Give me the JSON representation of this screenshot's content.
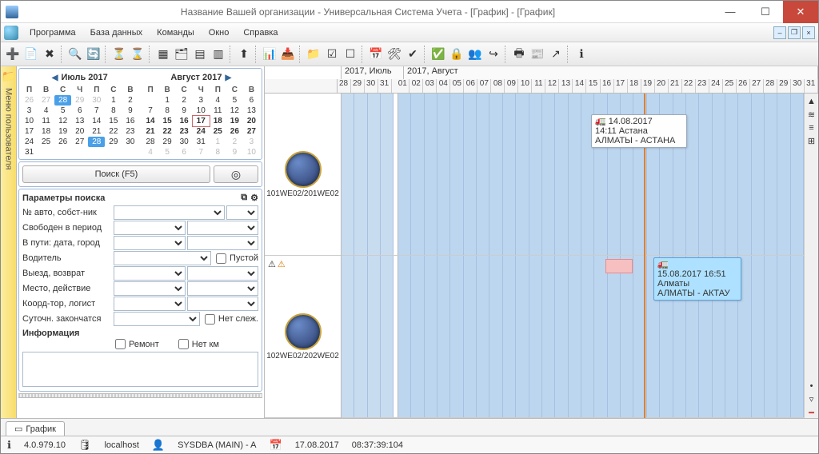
{
  "title": "Название Вашей организации - Универсальная Система Учета - [График] - [График]",
  "menu": {
    "program": "Программа",
    "db": "База данных",
    "cmds": "Команды",
    "window": "Окно",
    "help": "Справка"
  },
  "calendars": {
    "july": {
      "title": "Июль 2017",
      "dow": [
        "П",
        "В",
        "С",
        "Ч",
        "П",
        "С",
        "В"
      ],
      "cells": [
        [
          "26",
          "27",
          "28",
          "29",
          "30",
          "1",
          "2"
        ],
        [
          "3",
          "4",
          "5",
          "6",
          "7",
          "8",
          "9"
        ],
        [
          "10",
          "11",
          "12",
          "13",
          "14",
          "15",
          "16"
        ],
        [
          "17",
          "18",
          "19",
          "20",
          "21",
          "22",
          "23"
        ],
        [
          "24",
          "25",
          "26",
          "27",
          "28",
          "29",
          "30"
        ],
        [
          "31",
          "",
          "",
          "",
          "",
          "",
          ""
        ]
      ]
    },
    "aug": {
      "title": "Август 2017",
      "dow": [
        "П",
        "В",
        "С",
        "Ч",
        "П",
        "С",
        "В"
      ],
      "cells": [
        [
          "",
          "1",
          "2",
          "3",
          "4",
          "5",
          "6"
        ],
        [
          "7",
          "8",
          "9",
          "10",
          "11",
          "12",
          "13"
        ],
        [
          "14",
          "15",
          "16",
          "17",
          "18",
          "19",
          "20"
        ],
        [
          "21",
          "22",
          "23",
          "24",
          "25",
          "26",
          "27"
        ],
        [
          "28",
          "29",
          "30",
          "31",
          "1",
          "2",
          "3"
        ],
        [
          "4",
          "5",
          "6",
          "7",
          "8",
          "9",
          "10"
        ]
      ]
    }
  },
  "search": {
    "btn": "Поиск (F5)"
  },
  "params": {
    "header": "Параметры поиска",
    "rows": {
      "auto": "№ авто, собст-ник",
      "free": "Свободен в период",
      "route": "В пути: дата, город",
      "driver": "Водитель",
      "empty": "Пустой",
      "depart": "Выезд, возврат",
      "place": "Место, действие",
      "coord": "Коорд-тор, логист",
      "daily": "Суточн. закончатся",
      "notrack": "Нет слеж."
    },
    "info": "Информация",
    "repair": "Ремонт",
    "nokm": "Нет км"
  },
  "sidebar": {
    "label": "Меню пользователя"
  },
  "gantt": {
    "months": {
      "jul": "2017, Июль",
      "aug": "2017, Август"
    },
    "julyDays": [
      "28",
      "29",
      "30",
      "31"
    ],
    "augDays": [
      "01",
      "02",
      "03",
      "04",
      "05",
      "06",
      "07",
      "08",
      "09",
      "10",
      "11",
      "12",
      "13",
      "14",
      "15",
      "16",
      "17",
      "18",
      "19",
      "20",
      "21",
      "22",
      "23",
      "24",
      "25",
      "26",
      "27",
      "28",
      "29",
      "30",
      "31"
    ],
    "resources": [
      {
        "code": "101WE02/201WE02"
      },
      {
        "code": "102WE02/202WE02"
      }
    ],
    "events": {
      "e1": {
        "date": "14.08.2017",
        "time": "14:11 Астана",
        "route": "АЛМАТЫ - АСТАНА"
      },
      "e2": {
        "date": "15.08.2017 16:51",
        "city": "Алматы",
        "route": "АЛМАТЫ - АКТАУ"
      }
    }
  },
  "bottomTab": "График",
  "status": {
    "ver": "4.0.979.10",
    "host": "localhost",
    "user": "SYSDBA (MAIN) - A",
    "date": "17.08.2017",
    "time": "08:37:39:104"
  }
}
